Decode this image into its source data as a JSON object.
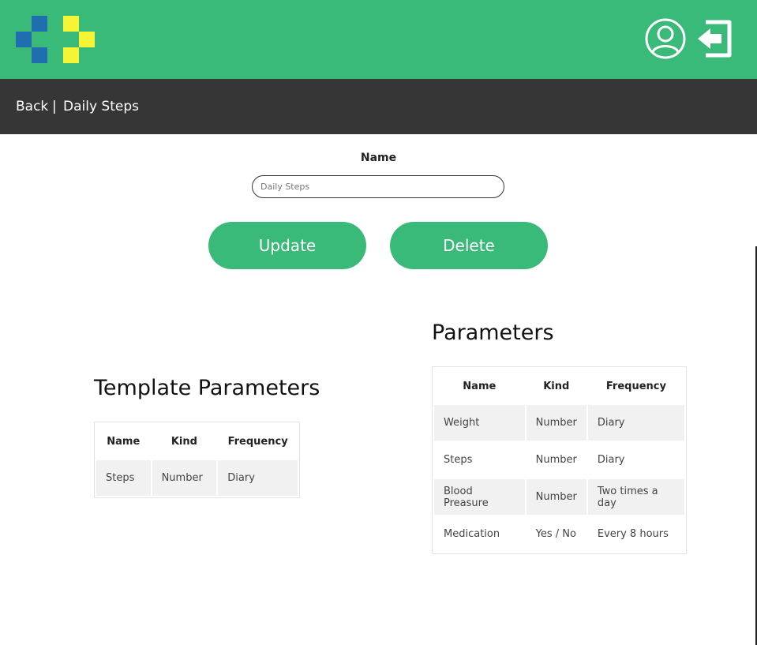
{
  "header": {
    "logo_icon": "cross-pixel-logo",
    "user_icon": "user-circle-icon",
    "logout_icon": "logout-icon",
    "colors": {
      "brand_green": "#3aba78",
      "logo_blue": "#1f6fb0",
      "logo_yellow": "#f5f535",
      "nav_dark": "#363636"
    }
  },
  "nav": {
    "back_label": "Back",
    "separator": "|",
    "current": "Daily Steps"
  },
  "form": {
    "name_label": "Name",
    "name_placeholder": "Daily Steps",
    "update_label": "Update",
    "delete_label": "Delete"
  },
  "template_parameters": {
    "title": "Template Parameters",
    "columns": [
      "Name",
      "Kind",
      "Frequency"
    ],
    "rows": [
      [
        "Steps",
        "Number",
        "Diary"
      ]
    ]
  },
  "parameters": {
    "title": "Parameters",
    "columns": [
      "Name",
      "Kind",
      "Frequency"
    ],
    "rows": [
      [
        "Weight",
        "Number",
        "Diary"
      ],
      [
        "Steps",
        "Number",
        "Diary"
      ],
      [
        "Blood Preasure",
        "Number",
        "Two times a day"
      ],
      [
        "Medication",
        "Yes / No",
        "Every 8 hours"
      ]
    ]
  }
}
